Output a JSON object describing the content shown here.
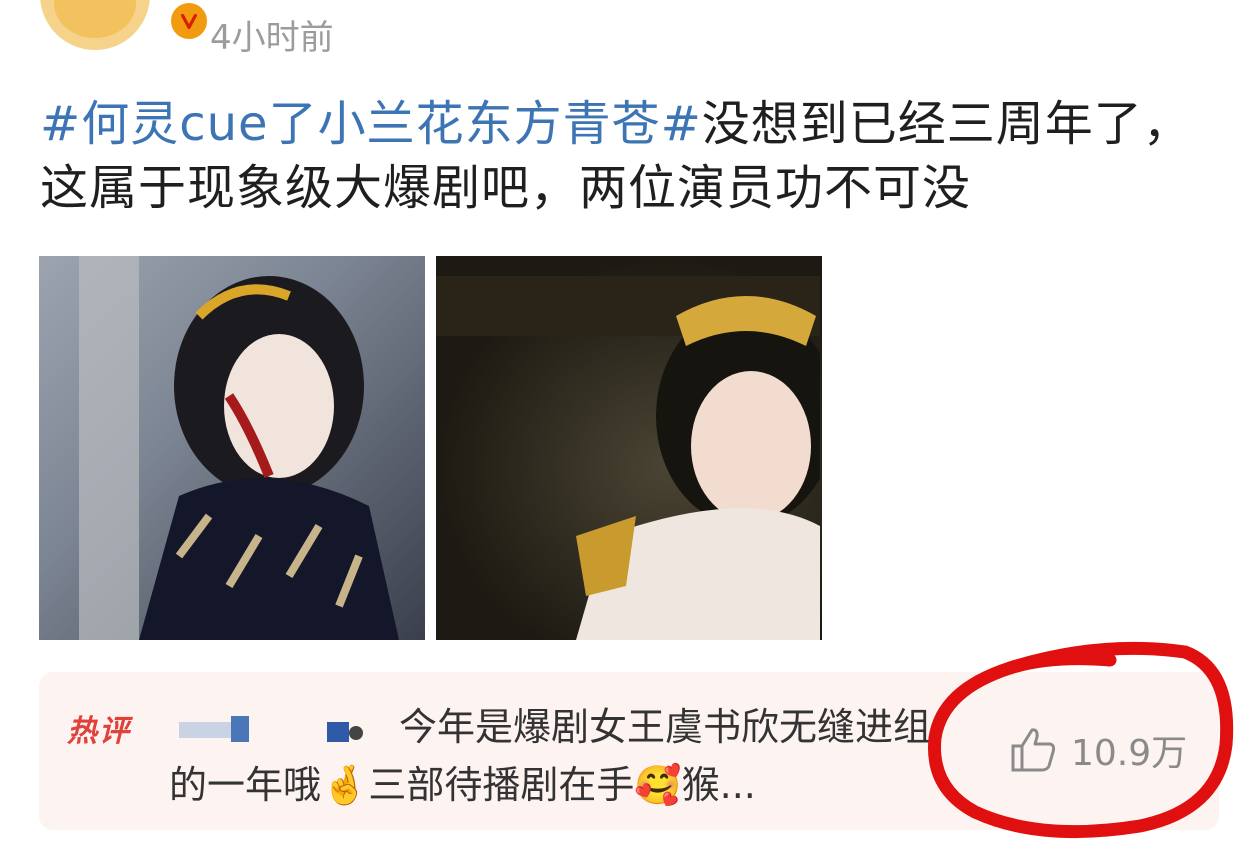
{
  "post": {
    "time": "4小时前",
    "topic": "#何灵cue了小兰花东方青苍#",
    "text": "没想到已经三周年了，这属于现象级大爆剧吧，两位演员功不可没"
  },
  "comment": {
    "tag": "热评",
    "text": "今年是爆剧女王虞书欣无缝进组的一年哦🤞三部待播剧在手🥰猴...",
    "likes": "10.9万"
  },
  "colors": {
    "topic": "#3c74b4",
    "hot_tag": "#e0413a",
    "annotation": "#e01010",
    "verified": "#f39b10"
  }
}
